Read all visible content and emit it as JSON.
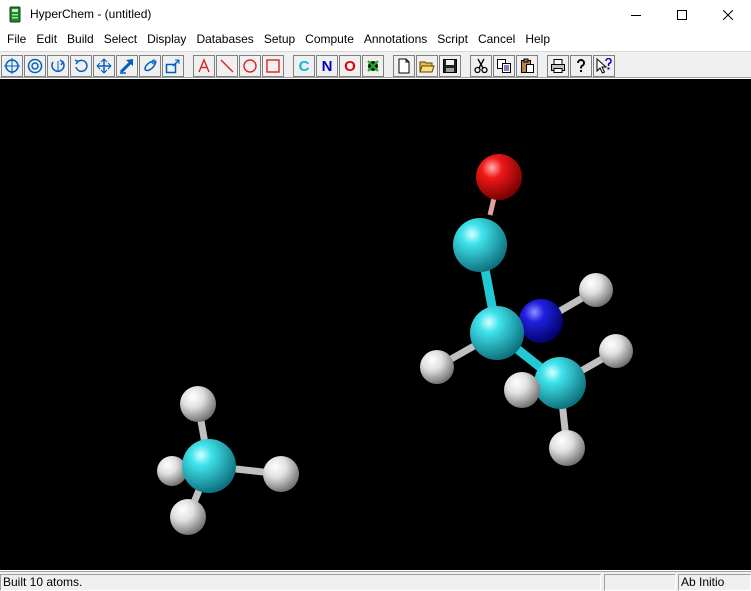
{
  "window": {
    "title": "HyperChem - (untitled)"
  },
  "menu": [
    "File",
    "Edit",
    "Build",
    "Select",
    "Display",
    "Databases",
    "Setup",
    "Compute",
    "Annotations",
    "Script",
    "Cancel",
    "Help"
  ],
  "toolbar": {
    "element_buttons": [
      "C",
      "N",
      "O"
    ],
    "element_colors": {
      "C": "#00c0d0",
      "N": "#0000c0",
      "O": "#e00000"
    }
  },
  "status": {
    "message": "Built 10 atoms.",
    "middle": "",
    "method": "Ab Initio"
  },
  "colors": {
    "canvas": "#000000",
    "carbon": "#22c8d4",
    "nitrogen": "#1c1cc8",
    "oxygen": "#e01010",
    "hydrogen": "#e8e8e8",
    "toolbar_icon_blue": "#0060c0",
    "toolbar_icon_red": "#e02020"
  }
}
